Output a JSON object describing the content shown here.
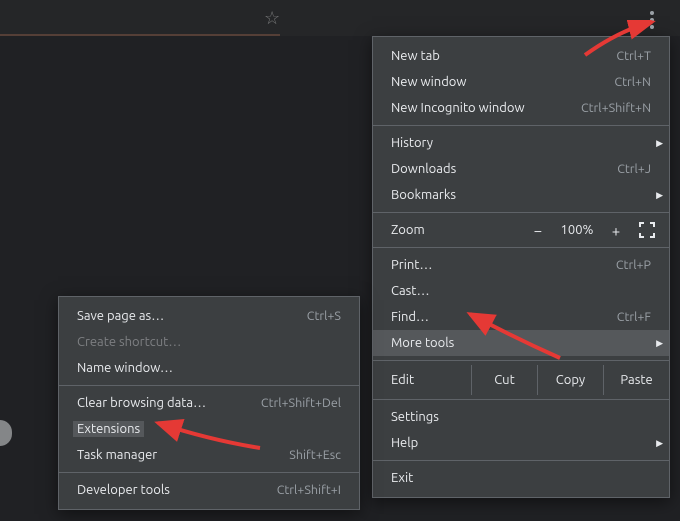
{
  "address_bar": {
    "star_glyph": "☆"
  },
  "kebab": {
    "name": "kebab-menu-icon"
  },
  "main_menu": {
    "new_tab": {
      "label": "New tab",
      "shortcut": "Ctrl+T"
    },
    "new_window": {
      "label": "New window",
      "shortcut": "Ctrl+N"
    },
    "new_incognito": {
      "label": "New Incognito window",
      "shortcut": "Ctrl+Shift+N"
    },
    "history": {
      "label": "History"
    },
    "downloads": {
      "label": "Downloads",
      "shortcut": "Ctrl+J"
    },
    "bookmarks": {
      "label": "Bookmarks"
    },
    "zoom": {
      "label": "Zoom",
      "minus": "−",
      "value": "100%",
      "plus": "+"
    },
    "print": {
      "label": "Print…",
      "shortcut": "Ctrl+P"
    },
    "cast": {
      "label": "Cast…"
    },
    "find": {
      "label": "Find…",
      "shortcut": "Ctrl+F"
    },
    "more_tools": {
      "label": "More tools"
    },
    "edit": {
      "label": "Edit",
      "cut": "Cut",
      "copy": "Copy",
      "paste": "Paste"
    },
    "settings": {
      "label": "Settings"
    },
    "help": {
      "label": "Help"
    },
    "exit": {
      "label": "Exit"
    }
  },
  "sub_menu": {
    "save_page": {
      "label": "Save page as…",
      "shortcut": "Ctrl+S"
    },
    "create_shortcut": {
      "label": "Create shortcut…"
    },
    "name_window": {
      "label": "Name window…"
    },
    "clear_browsing": {
      "label": "Clear browsing data…",
      "shortcut": "Ctrl+Shift+Del"
    },
    "extensions": {
      "label": "Extensions"
    },
    "task_manager": {
      "label": "Task manager",
      "shortcut": "Shift+Esc"
    },
    "developer_tools": {
      "label": "Developer tools",
      "shortcut": "Ctrl+Shift+I"
    }
  }
}
